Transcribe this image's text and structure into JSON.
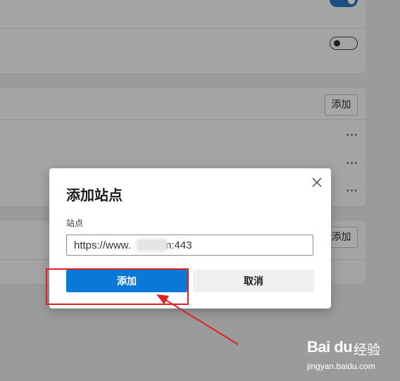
{
  "background": {
    "mid_card": {
      "add_label": "添加"
    },
    "bottom_card": {
      "add_label": "添加"
    }
  },
  "dialog": {
    "title": "添加站点",
    "field_label": "站点",
    "input_value": "https://www.       com:443",
    "add_button": "添加",
    "cancel_button": "取消"
  },
  "watermark": {
    "brand": "Bai du",
    "cn": "经验",
    "url": "jingyan.baidu.com"
  },
  "colors": {
    "primary_button": "#0a78d7",
    "annotation_red": "#e02020",
    "overlay_gray": "#9b9b9b"
  },
  "icons": [
    "close-icon",
    "more-icon",
    "toggle-on",
    "toggle-off",
    "arrow-annotation"
  ]
}
